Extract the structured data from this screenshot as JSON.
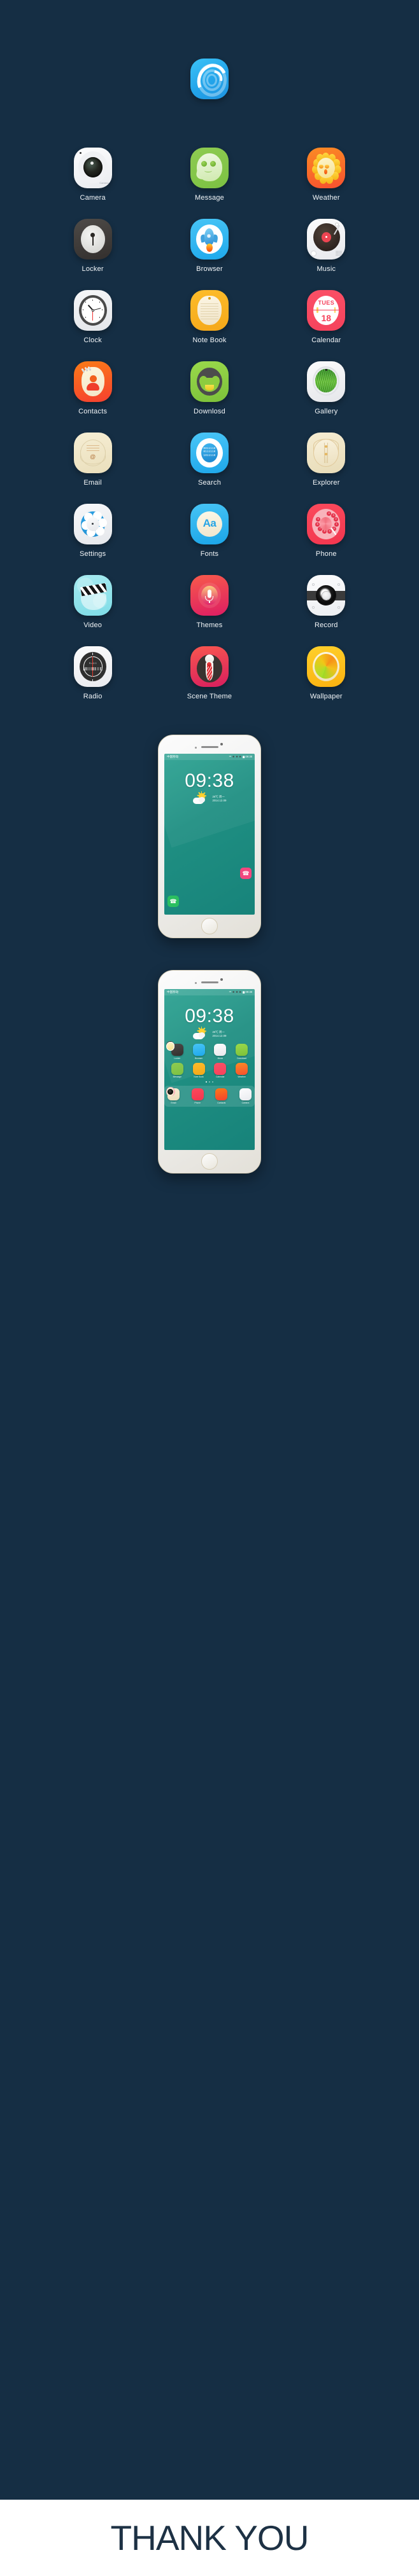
{
  "background_color": "#152e44",
  "hero": {
    "icon_name": "spiral-ripple-logo"
  },
  "apps": [
    {
      "label": "Camera",
      "icon": "camera-icon",
      "color": "#f1f2f5"
    },
    {
      "label": "Message",
      "icon": "ghost-message-icon",
      "color": "#82c54a"
    },
    {
      "label": "Weather",
      "icon": "sunflower-icon",
      "color": "#f8631f"
    },
    {
      "label": "Locker",
      "icon": "keyhole-lock-icon",
      "color": "#3b3836"
    },
    {
      "label": "Browser",
      "icon": "rocket-icon",
      "color": "#28ade f"
    },
    {
      "label": "Music",
      "icon": "vinyl-record-icon",
      "color": "#eceef1"
    },
    {
      "label": "Clock",
      "icon": "analog-clock-icon",
      "color": "#eceef1"
    },
    {
      "label": "Note Book",
      "icon": "notepad-icon",
      "color": "#f8ae1c"
    },
    {
      "label": "Calendar",
      "icon": "calendar-icon",
      "color": "#f5425c"
    },
    {
      "label": "Contacts",
      "icon": "contact-card-icon",
      "color": "#f6522a"
    },
    {
      "label": "Downlosd",
      "icon": "download-face-icon",
      "color": "#85c83e"
    },
    {
      "label": "Gallery",
      "icon": "grass-photo-icon",
      "color": "#ebedf0"
    },
    {
      "label": "Email",
      "icon": "envelope-at-icon",
      "color": "#efe5c8"
    },
    {
      "label": "Search",
      "icon": "binary-search-icon",
      "color": "#25ace9"
    },
    {
      "label": "Explorer",
      "icon": "folder-zip-icon",
      "color": "#ece0bd"
    },
    {
      "label": "Settings",
      "icon": "gear-flower-icon",
      "color": "#eef0f3"
    },
    {
      "label": "Fonts",
      "icon": "font-aa-icon",
      "color": "#25ace9"
    },
    {
      "label": "Phone",
      "icon": "rotary-dial-icon",
      "color": "#f43b52"
    },
    {
      "label": "Video",
      "icon": "clapperboard-icon",
      "color": "#8fe1e9"
    },
    {
      "label": "Themes",
      "icon": "microphone-icon",
      "color": "#e62f5d"
    },
    {
      "label": "Record",
      "icon": "speaker-icon",
      "color": "#f3f4f6"
    },
    {
      "label": "Radio",
      "icon": "tuner-dial-icon",
      "color": "#f3f4f6"
    },
    {
      "label": "Scene Theme",
      "icon": "suit-tie-icon",
      "color": "#e52a58"
    },
    {
      "label": "Wallpaper",
      "icon": "color-swirl-icon",
      "color": "#fcb813"
    }
  ],
  "calendar_icon": {
    "weekday": "TUES",
    "day": "18"
  },
  "fonts_icon": {
    "sample": "Aa"
  },
  "search_icon": {
    "binary_lines": [
      "0011110",
      "0111110",
      "1011110"
    ]
  },
  "radio_icon": {
    "frequency": "R=80.3"
  },
  "camera_icon": {
    "wordmark": "Camera"
  },
  "phone_icon": {
    "digits": [
      "1",
      "2",
      "3",
      "4",
      "5",
      "6",
      "7",
      "8",
      "9",
      "0"
    ]
  },
  "phone_mockups": [
    {
      "name": "lockscreen-phone",
      "statusbar": {
        "carrier": "中国移动",
        "indicators": "ᴳ³ ◾◾◾ ▆ 09:38"
      },
      "time": "09:38",
      "weather": {
        "temperature": "26℃",
        "weekday": "周一",
        "date": "2014.12.09",
        "condition_icon": "sun-behind-cloud-icon"
      },
      "dock": [
        {
          "name": "phone-shortcut",
          "glyph": "☎",
          "color": "#2bbf60"
        },
        {
          "name": "message-shortcut",
          "glyph": "☎",
          "color": "#f3477f"
        }
      ]
    },
    {
      "name": "homescreen-phone",
      "statusbar": {
        "carrier": "中国移动",
        "indicators": "ᴳ³ ◾◾◾ ▆ 09:38"
      },
      "time": "09:38",
      "weather": {
        "temperature": "26℃",
        "weekday": "周一",
        "date": "2014.12.09",
        "condition_icon": "sun-behind-cloud-icon"
      },
      "grid": [
        {
          "label": "Locker",
          "color": "#3b3836"
        },
        {
          "label": "Browser",
          "color": "#25ace9"
        },
        {
          "label": "Music",
          "color": "#eceef1"
        },
        {
          "label": "Download",
          "color": "#85c83e"
        },
        {
          "label": "Message",
          "color": "#82c54a"
        },
        {
          "label": "Note Book",
          "color": "#f8ae1c"
        },
        {
          "label": "Calendar",
          "color": "#f5425c"
        },
        {
          "label": "Weather",
          "color": "#f8631f"
        }
      ],
      "page_dots": 3,
      "active_dot": 1,
      "dock": [
        {
          "label": "Email",
          "color": "#efe5c8"
        },
        {
          "label": "Phone",
          "color": "#f43b52"
        },
        {
          "label": "Contacts",
          "color": "#f6522a"
        },
        {
          "label": "Camera",
          "color": "#eceef1"
        }
      ]
    }
  ],
  "footer": {
    "text": "THANK YOU"
  }
}
